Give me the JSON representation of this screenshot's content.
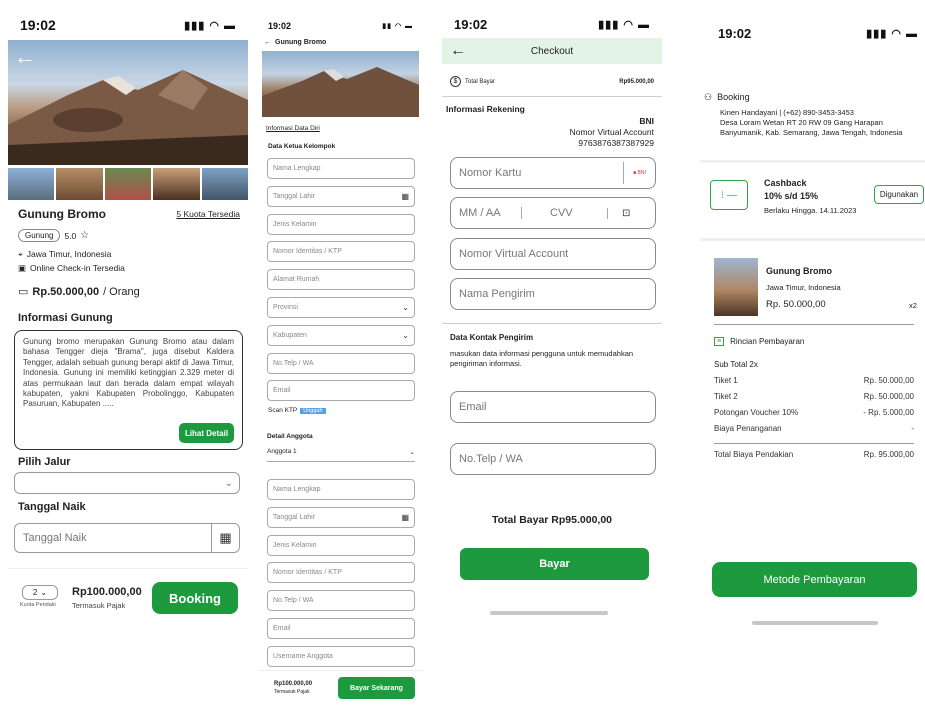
{
  "status": {
    "time": "19:02"
  },
  "screen1": {
    "title": "Gunung Bromo",
    "quota": "5 Kuota Tersedia",
    "tag": "Gunung",
    "rating": "5.0",
    "location": "Jawa Timur, Indonesia",
    "checkin": "Online Check-in Tersedia",
    "price": "Rp.50.000,00",
    "price_unit": "/ Orang",
    "info_heading": "Informasi Gunung",
    "description": "Gunung bromo merupakan Gunung Bromo atau dalam bahasa Tengger dieja \"Brama\", juga disebut Kaldera Tengger, adalah sebuah gunung berapi aktif di Jawa Timur, Indonesia. Gunung ini memiliki ketinggian 2.329 meter di atas permukaan laut dan berada dalam empat wilayah kabupaten, yakni Kabupaten Probolinggo, Kabupaten Pasuruan, Kabupaten .....",
    "detail_button": "Lihat Detail",
    "route_heading": "Pilih Jalur",
    "date_heading": "Tanggal Naik",
    "date_placeholder": "Tanggal Naik",
    "climbers_value": "2",
    "climbers_label": "Kuota Pendaki",
    "total": "Rp100.000,00",
    "tax": "Termasuk Pajak",
    "booking_button": "Booking"
  },
  "screen2": {
    "title": "Gunung Bromo",
    "tab": "Informasi Data Diri",
    "leader_heading": "Data Ketua Kelompok",
    "leader_fields": [
      "Nama Lengkap",
      "Tanggal Lahir",
      "Jenis Kelamin",
      "Nomor Identitas / KTP",
      "Alamat Rumah",
      "Provinsi",
      "Kabupaten",
      "No.Telp / WA",
      "Email"
    ],
    "scan_label": "Scan KTP",
    "scan_badge": "Unggah",
    "member_heading": "Detail Anggota",
    "member_select": "Anggota 1",
    "member_fields": [
      "Nama Lengkap",
      "Tanggal Lahir",
      "Jenis Kelamin",
      "Nomor Identitas / KTP",
      "No.Telp / WA",
      "Email",
      "Username Anggota"
    ],
    "total": "Rp100.000,00",
    "tax": "Termasuk Pajak",
    "pay_button": "Bayar Sekarang"
  },
  "screen3": {
    "title": "Checkout",
    "total_label": "Total Bayar",
    "total_value": "Rp95.000,00",
    "account_heading": "Informasi Rekening",
    "bank": "BNI",
    "va_label": "Nomor Virtual Account",
    "va_number": "9763876387387929",
    "card_placeholder": "Nomor Kartu",
    "expiry_placeholder": "MM / AA",
    "cvv_placeholder": "CVV",
    "va_placeholder": "Nomor Virtual Account",
    "sender_placeholder": "Nama Pengirim",
    "contact_heading": "Data Kontak Pengirim",
    "contact_desc": "masukan data informasi pengguna untuk memudahkan pengiriman informasi.",
    "email_placeholder": "Email",
    "phone_placeholder": "No.Telp / WA",
    "total_bottom": "Total Bayar Rp95.000,00",
    "pay_button": "Bayar"
  },
  "screen4": {
    "booking_heading": "Booking",
    "booking_contact": "Kinen Handayani | (+62) 890-3453-3453",
    "booking_address": "Desa Loram Wetan RT 20 RW 09 Gang Harapan Banyumanik, Kab. Semarang, Jawa Tengah, Indonesia",
    "cashback_title": "Cashback",
    "cashback_value": "10% s/d 15%",
    "cashback_valid": "Berlaku Hingga. 14.11.2023",
    "cashback_button": "Digunakan",
    "item_title": "Gunung Bromo",
    "item_location": "Jawa Timur, Indonesia",
    "item_price": "Rp. 50.000,00",
    "item_qty": "x2",
    "summary_heading": "Rincian Pembayaran",
    "subtotal": "Sub Total 2x",
    "rows": [
      {
        "label": "Tiket 1",
        "value": "Rp. 50.000,00"
      },
      {
        "label": "Tiket 2",
        "value": "Rp. 50.000,00"
      },
      {
        "label": "Potongan Voucher 10%",
        "value": "- Rp. 5.000,00"
      },
      {
        "label": "Biaya Penanganan",
        "value": "-"
      }
    ],
    "total_label": "Total Biaya Pendakian",
    "total_value": "Rp. 95.000,00",
    "method_button": "Metode Pembayaran"
  },
  "colors": {
    "accent": "#1e9a3e",
    "checkout_header": "#e3f4e6"
  }
}
